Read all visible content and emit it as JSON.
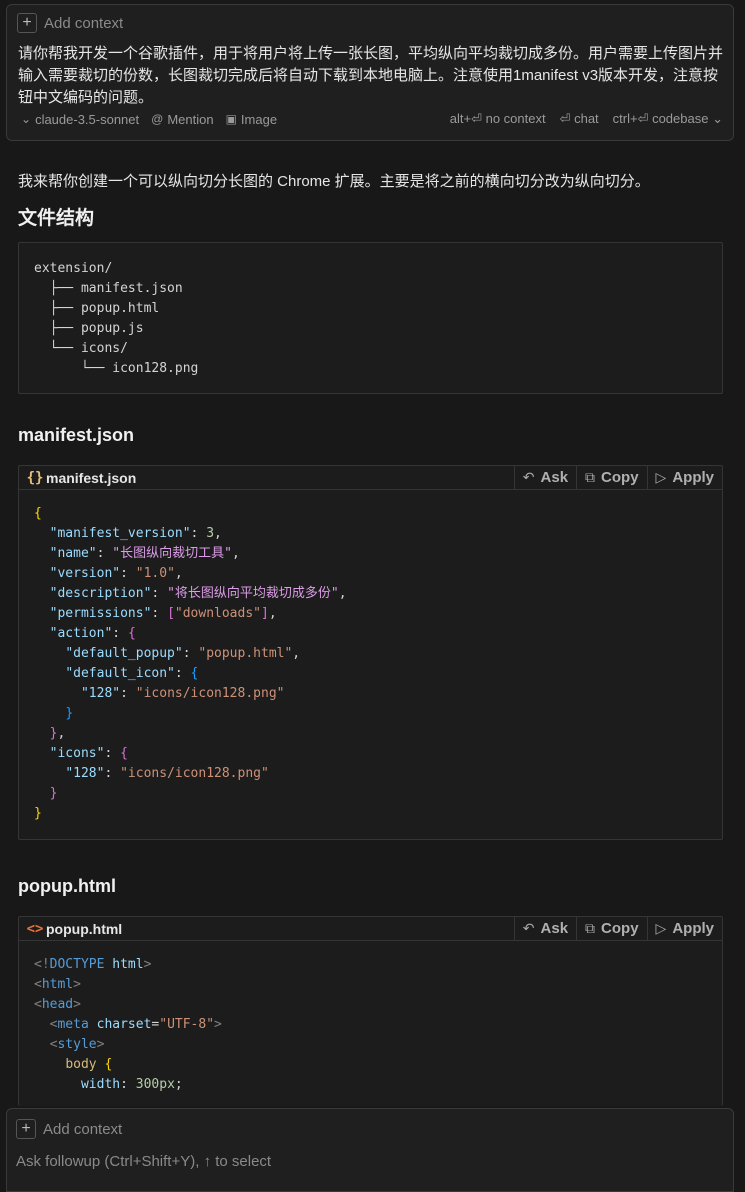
{
  "composer": {
    "add_context": "Add context",
    "prompt": "请你帮我开发一个谷歌插件，用于将用户将上传一张长图，平均纵向平均裁切成多份。用户需要上传图片并输入需要裁切的份数，长图裁切完成后将自动下载到本地电脑上。注意使用1manifest v3版本开发，注意按钮中文编码的问题。",
    "model": "claude-3.5-sonnet",
    "mention": "Mention",
    "image": "Image",
    "no_context": "alt+⏎ no context",
    "chat": "⏎ chat",
    "codebase": "ctrl+⏎ codebase"
  },
  "response": {
    "intro": "我来帮你创建一个可以纵向切分长图的 Chrome 扩展。主要是将之前的横向切分改为纵向切分。",
    "structure_heading": "文件结构",
    "tree": "extension/\n  ├── manifest.json\n  ├── popup.html\n  ├── popup.js\n  └── icons/\n      └── icon128.png",
    "manifest_heading": "manifest.json",
    "popup_heading": "popup.html"
  },
  "code_blocks": [
    {
      "filename": "manifest.json",
      "icon": "{}",
      "icon_color": "#e5c07b"
    },
    {
      "filename": "popup.html",
      "icon": "<>",
      "icon_color": "#e8743b"
    }
  ],
  "actions": {
    "ask": "Ask",
    "copy": "Copy",
    "apply": "Apply"
  },
  "followup": {
    "add_context": "Add context",
    "placeholder": "Ask followup (Ctrl+Shift+Y), ↑ to select"
  }
}
